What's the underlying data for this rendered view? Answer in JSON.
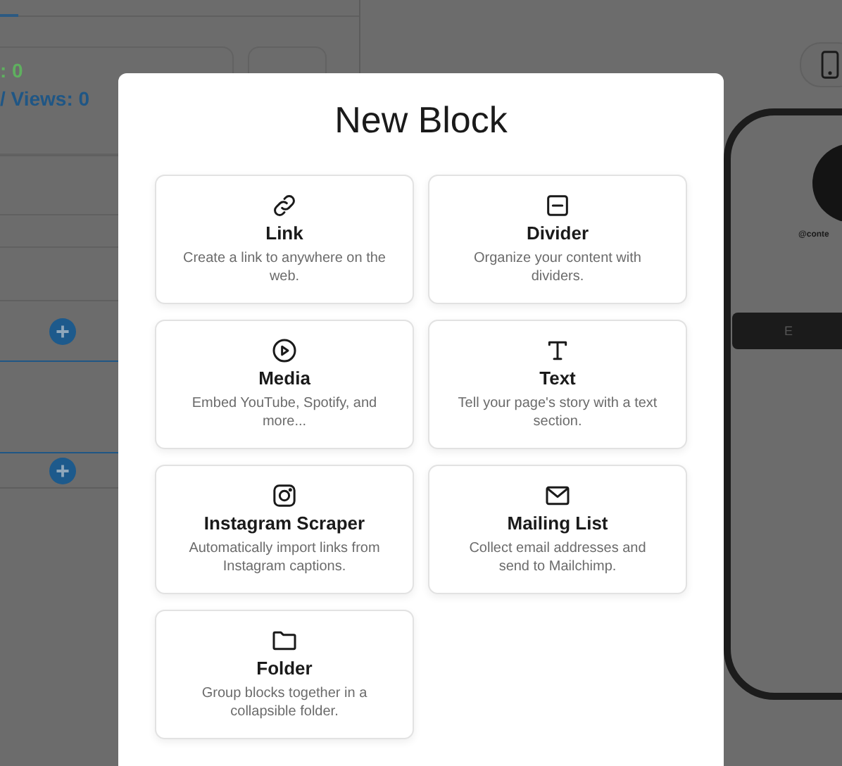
{
  "stats": {
    "clicks": ": 0",
    "views": "/ Views: 0"
  },
  "preview": {
    "handle": "@conte",
    "button_label": "E"
  },
  "modal": {
    "title": "New Block",
    "blocks": [
      {
        "kind": "link",
        "title": "Link",
        "description": "Create a link to anywhere on the web."
      },
      {
        "kind": "divider",
        "title": "Divider",
        "description": "Organize your content with dividers."
      },
      {
        "kind": "media",
        "title": "Media",
        "description": "Embed YouTube, Spotify, and more..."
      },
      {
        "kind": "text",
        "title": "Text",
        "description": "Tell your page's story with a text section."
      },
      {
        "kind": "instagram",
        "title": "Instagram Scraper",
        "description": "Automatically import links from Instagram captions."
      },
      {
        "kind": "mail",
        "title": "Mailing List",
        "description": "Collect email addresses and send to Mailchimp."
      },
      {
        "kind": "folder",
        "title": "Folder",
        "description": "Group blocks together in a collapsible folder."
      }
    ]
  }
}
